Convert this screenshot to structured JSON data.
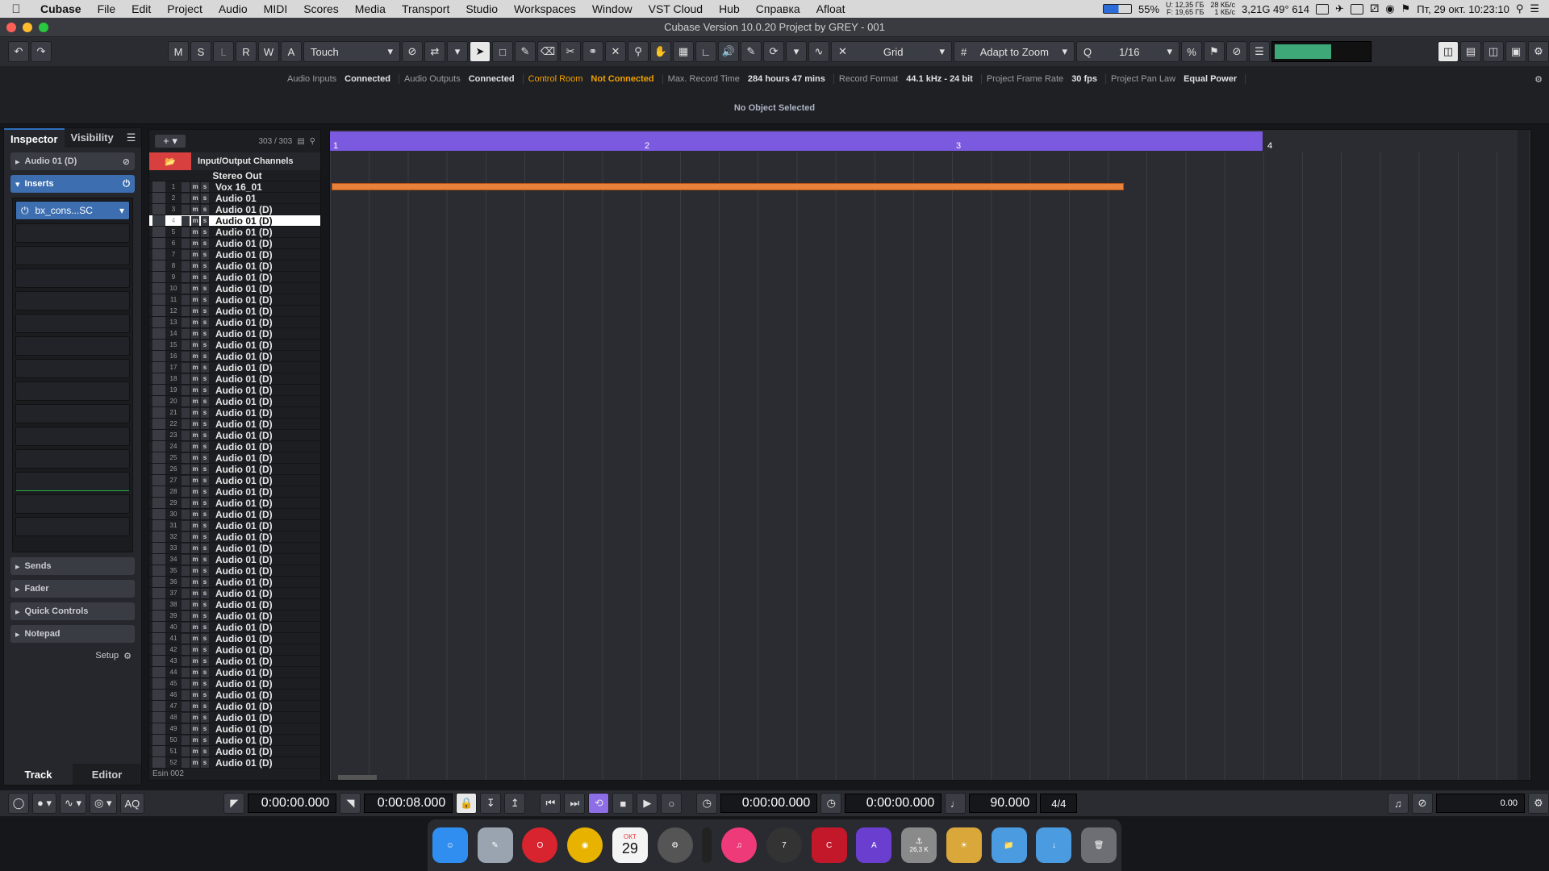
{
  "menubar": {
    "app": "Cubase",
    "items": [
      "File",
      "Edit",
      "Project",
      "Audio",
      "MIDI",
      "Scores",
      "Media",
      "Transport",
      "Studio",
      "Workspaces",
      "Window",
      "VST Cloud",
      "Hub",
      "Справка",
      "Afloat"
    ],
    "status": {
      "battery": "55%",
      "disk_u": "U: 12,35 ГБ",
      "disk_f": "F: 19,65 ГБ",
      "net_up": "28 КБ/с",
      "net_down": "1 КБ/с",
      "stats": "3,21G 49° 614",
      "datetime": "Пт, 29 окт. 10:23:10"
    }
  },
  "titlebar": {
    "title": "Cubase Version 10.0.20 Project by GREY - 001"
  },
  "toolbar": {
    "msrwa": [
      "M",
      "S",
      "L",
      "R",
      "W",
      "A"
    ],
    "automation_mode": "Touch",
    "snap_type": "Grid",
    "grid_mode": "Adapt to Zoom",
    "quantize": "1/16"
  },
  "infobar": {
    "fields": [
      {
        "key": "Audio Inputs",
        "value": "Connected"
      },
      {
        "key": "Audio Outputs",
        "value": "Connected"
      },
      {
        "key": "Control Room",
        "value": "Not Connected",
        "warn": true
      },
      {
        "key": "Max. Record Time",
        "value": "284 hours 47 mins"
      },
      {
        "key": "Record Format",
        "value": "44.1 kHz - 24 bit"
      },
      {
        "key": "Project Frame Rate",
        "value": "30 fps"
      },
      {
        "key": "Project Pan Law",
        "value": "Equal Power"
      }
    ],
    "object_selected": "No Object Selected"
  },
  "inspector": {
    "tabs": [
      "Inspector",
      "Visibility"
    ],
    "track_name": "Audio 01 (D)",
    "inserts_label": "Inserts",
    "insert_slot_1": "bx_cons...SC",
    "sections": [
      "Sends",
      "Fader",
      "Quick Controls",
      "Notepad"
    ],
    "setup": "Setup",
    "bottom_tabs": [
      "Track",
      "Editor"
    ]
  },
  "tracklist": {
    "count": "303 / 303",
    "folder": "Input/Output Channels",
    "stereo_out": "Stereo Out",
    "first_track": "Vox 16_01",
    "second_track": "Audio 01",
    "repeated_track": "Audio 01 (D)",
    "footer": "Esin 002"
  },
  "ruler": {
    "bars": [
      "1",
      "2",
      "3",
      "4"
    ]
  },
  "transport": {
    "left_locator": "0:00:00.000",
    "right_locator": "0:00:08.000",
    "primary_time": "0:00:00.000",
    "secondary_time": "0:00:00.000",
    "tempo": "90.000",
    "signature": "4/4",
    "aq": "AQ",
    "level": "0.00"
  },
  "dock": {
    "calendar_month": "ОКТ",
    "calendar_day": "29",
    "badge": "26,3 K"
  }
}
